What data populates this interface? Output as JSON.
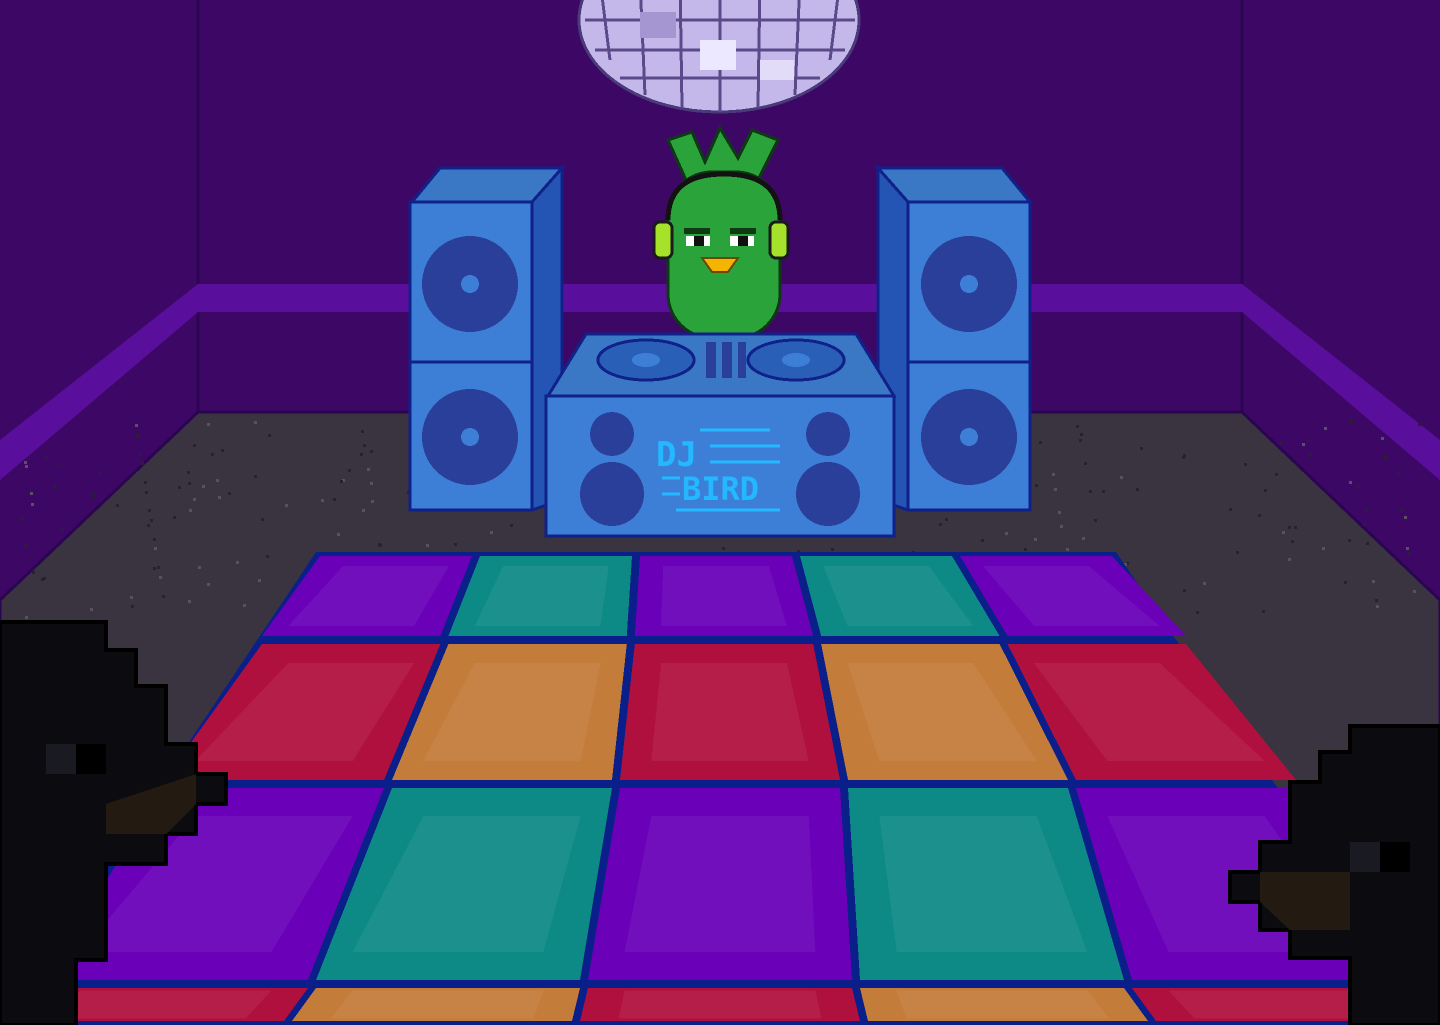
{
  "scene": {
    "title": "",
    "booth_logo": {
      "line1": "DJ",
      "line2": "BIRD"
    }
  },
  "colors": {
    "wall": "#3d0766",
    "wall_trim": "#5a0e9c",
    "floor_carpet": "#3a3340",
    "speaker_blue": "#3d7fd6",
    "speaker_dark": "#2a3f9a",
    "grid_line": "#0b1f8a",
    "tile_purple": "#6a00b8",
    "tile_teal": "#0d8a86",
    "tile_red": "#b0103e",
    "tile_orange": "#c47c3a",
    "bird_green": "#2aa33a",
    "headphone": "#a6e22a",
    "beak": "#f5b400",
    "logo_text": "#23b8ff"
  },
  "icons": [
    "disco-ball-icon",
    "speaker-icon",
    "turntable-icon",
    "headphones-icon",
    "crow-silhouette-icon"
  ]
}
